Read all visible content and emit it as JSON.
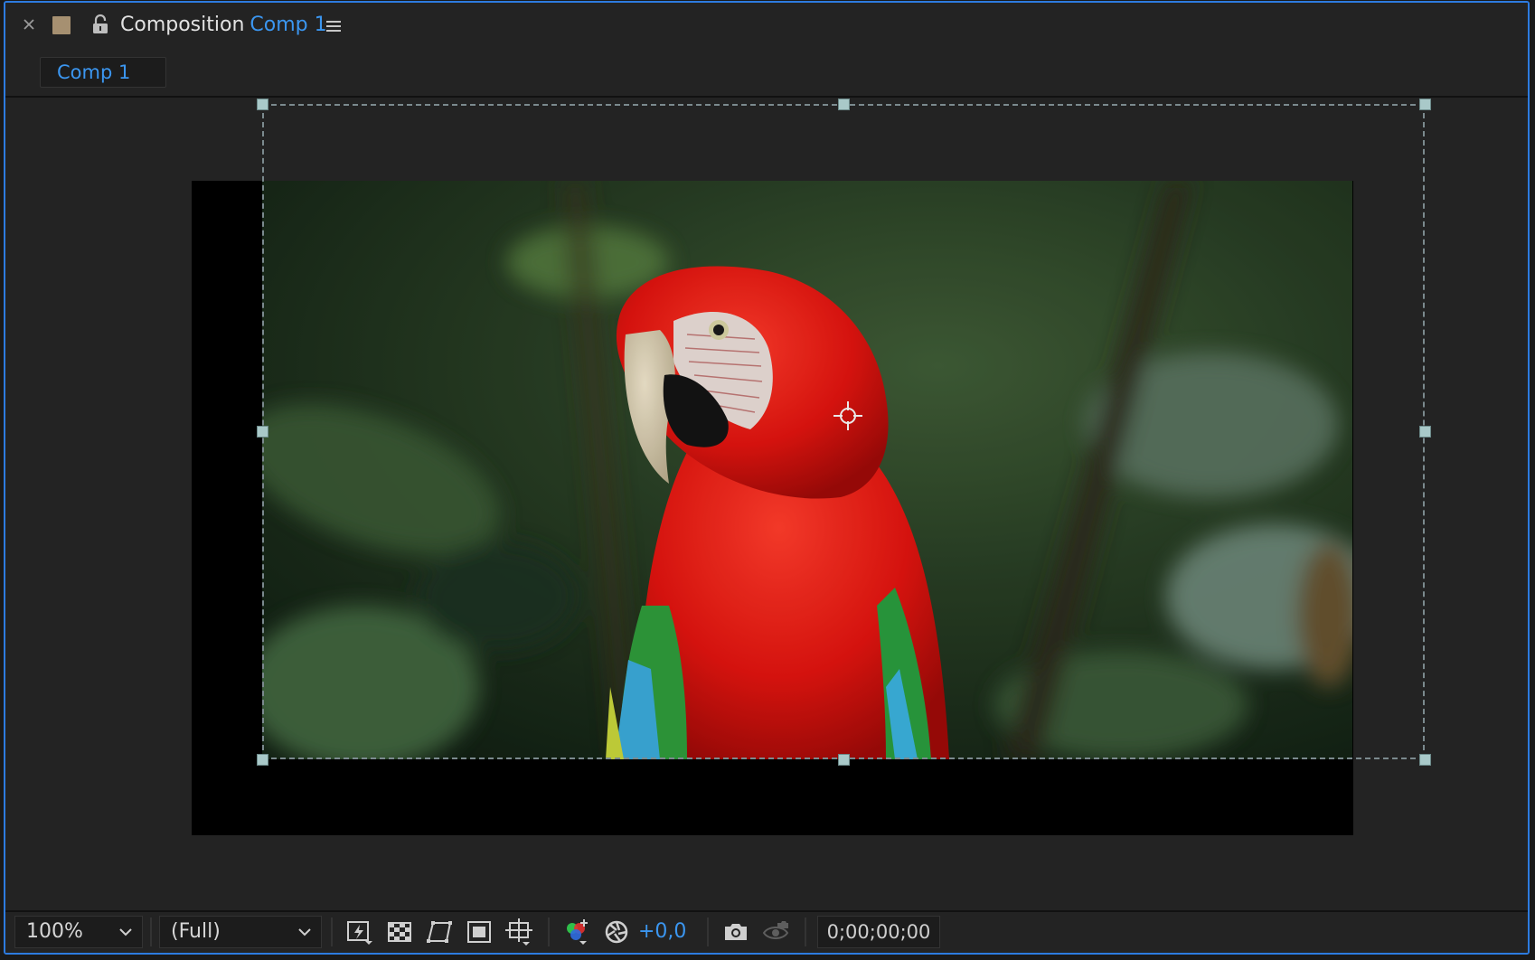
{
  "header": {
    "panel_label": "Composition",
    "comp_name": "Comp 1"
  },
  "tabs": [
    {
      "label": "Comp 1",
      "active": true
    }
  ],
  "viewer": {
    "footage_subject": "macaw"
  },
  "toolbar": {
    "zoom": "100%",
    "resolution": "(Full)",
    "exposure": "+0,0",
    "timecode": "0;00;00;00"
  },
  "colors": {
    "accent": "#3b96f0",
    "panel_border": "#2d7be0",
    "label_swatch": "#a69071",
    "handle": "#a9c9c9"
  }
}
